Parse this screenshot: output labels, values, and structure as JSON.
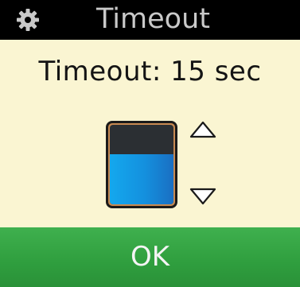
{
  "header": {
    "title": "Timeout",
    "icon": "gear-icon"
  },
  "setting": {
    "label": "Timeout: 15 sec",
    "level_fraction": 0.63,
    "fill_color": "#1497e6",
    "empty_color": "#2b2f33"
  },
  "controls": {
    "increase_icon": "chevron-up-icon",
    "decrease_icon": "chevron-down-icon"
  },
  "footer": {
    "ok_label": "OK",
    "ok_color": "#34a444"
  },
  "colors": {
    "background": "#faf5d2",
    "header_bg": "#000000",
    "header_text": "#c9c9c9"
  }
}
